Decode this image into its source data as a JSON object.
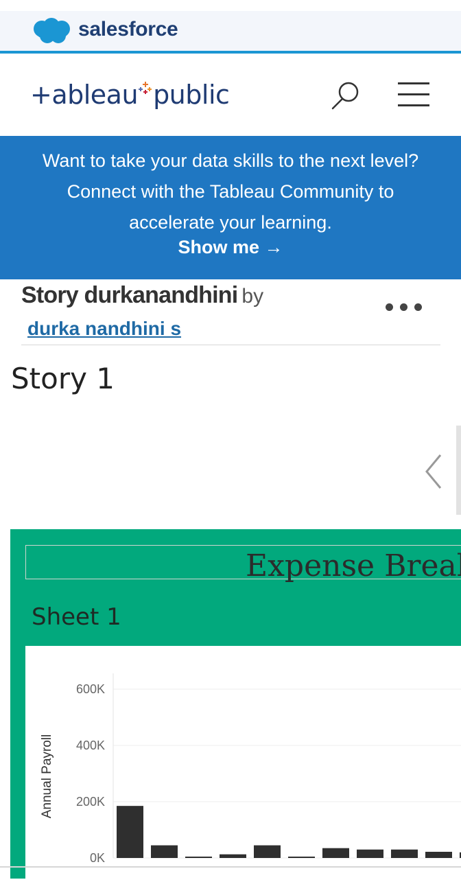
{
  "salesforce_bar": {
    "brand": "salesforce",
    "icon": "salesforce-cloud-icon"
  },
  "header": {
    "logo_left": "+ableau",
    "logo_right": "public",
    "search_icon": "search-icon",
    "menu_icon": "hamburger-menu-icon"
  },
  "promo": {
    "text": "Want to take your data skills to the next level? Connect with the Tableau Community to accelerate your learning.",
    "link": "Show me →"
  },
  "story": {
    "title": "Story durkanandhini",
    "by": "by",
    "author": "durka nandhini s",
    "more_icon": "more-options-icon",
    "name": "Story 1",
    "prev_icon": "chevron-left-icon"
  },
  "dashboard": {
    "title": "Expense Break",
    "sheet": "Sheet 1"
  },
  "colors": {
    "salesforce_blue": "#1b96d3",
    "promo_blue": "#1f77c2",
    "dashboard_green": "#02a97d",
    "bar": "#2f2f2f"
  },
  "chart_data": {
    "type": "bar",
    "ylabel": "Annual Payroll",
    "ylim": [
      0,
      650000
    ],
    "yticks": [
      {
        "value": 0,
        "label": "0K"
      },
      {
        "value": 200000,
        "label": "200K"
      },
      {
        "value": 400000,
        "label": "400K"
      },
      {
        "value": 600000,
        "label": "600K"
      }
    ],
    "values": [
      185000,
      45000,
      4000,
      13000,
      45000,
      4000,
      35000,
      30000,
      30000,
      22000,
      20000
    ]
  }
}
